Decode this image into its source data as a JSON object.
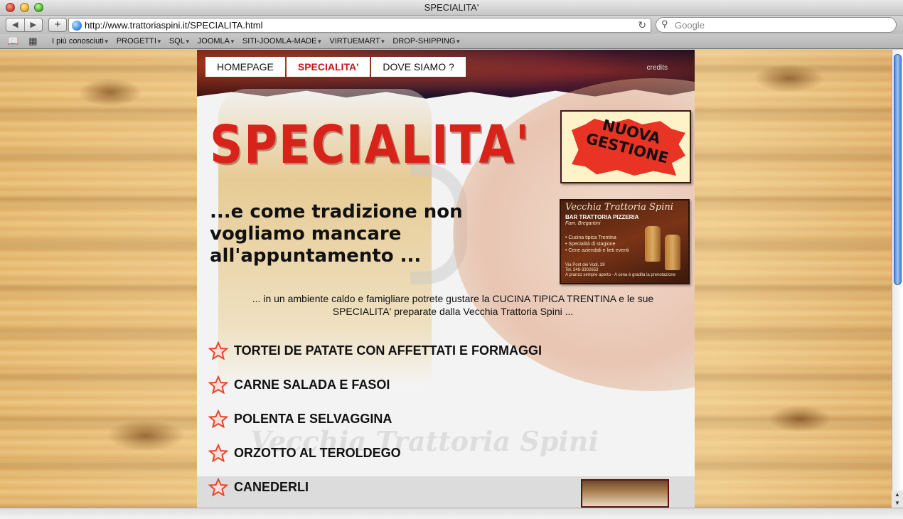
{
  "window": {
    "title": "SPECIALITA'"
  },
  "toolbar": {
    "back_glyph": "◀",
    "forward_glyph": "▶",
    "add_glyph": "+",
    "url": "http://www.trattoriaspini.it/SPECIALITA.html",
    "reload_glyph": "↻",
    "search_placeholder": "Google"
  },
  "bookmarks": {
    "items": [
      {
        "label": "I più conosciuti",
        "caret": "▼"
      },
      {
        "label": "PROGETTI",
        "caret": "▼"
      },
      {
        "label": "SQL",
        "caret": "▼"
      },
      {
        "label": "JOOMLA",
        "caret": "▼"
      },
      {
        "label": "SITI-JOOMLA-MADE",
        "caret": "▼"
      },
      {
        "label": "VIRTUEMART",
        "caret": "▼"
      },
      {
        "label": "DROP-SHIPPING",
        "caret": "▼"
      }
    ]
  },
  "site": {
    "nav": [
      {
        "label": "HOMEPAGE",
        "active": false
      },
      {
        "label": "SPECIALITA'",
        "active": true
      },
      {
        "label": "DOVE SIAMO ?",
        "active": false
      }
    ],
    "credits": "credits",
    "title": "SPECIALITA'",
    "tagline": "...e come tradizione non vogliamo mancare all'appuntamento ...",
    "intro": "... in un ambiente caldo e famigliare potrete gustare la CUCINA TIPICA TRENTINA e le sue SPECIALITA' preparate dalla Vecchia Trattoria Spini ...",
    "badge": {
      "line1": "NUOVA",
      "line2": "GESTIONE"
    },
    "card": {
      "name": "Vecchia Trattoria Spini",
      "subtitle": "BAR TRATTORIA PIZZERIA",
      "family": "Fam. Bregantini",
      "bullets": [
        "• Cucina tipica Trentina",
        "• Specialità di stagione",
        "• Cene aziendali e lieti eventi"
      ],
      "address": "Via Pont dei Vodi, 39",
      "phone": "Tel. 349-3302653",
      "note": "A pranzo sempre aperto - A cena è gradita la prenotazione"
    },
    "specialties": [
      "TORTEI DE PATATE CON AFFETTATI E FORMAGGI",
      "CARNE SALADA E FASOI",
      "POLENTA E SELVAGGINA",
      "ORZOTTO AL TEROLDEGO",
      "CANEDERLI"
    ],
    "watermark": "Vecchia Trattoria Spini"
  },
  "colors": {
    "accent_red": "#c4161c",
    "title_red": "#d8231b",
    "scroll_blue": "#4c83d3"
  }
}
